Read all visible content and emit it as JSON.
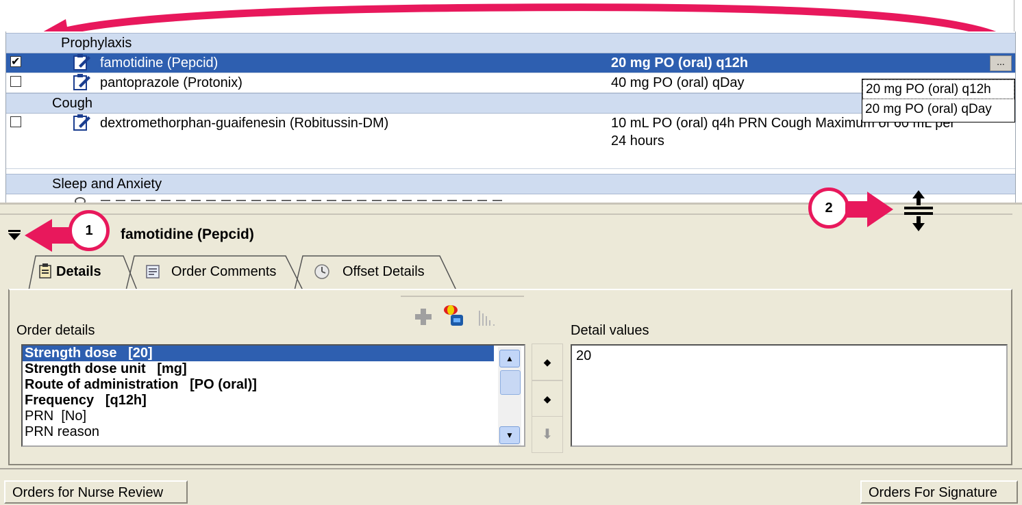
{
  "order_list": {
    "groups": [
      {
        "label": "Prophylaxis"
      },
      {
        "label": "Cough"
      },
      {
        "label": "Sleep and Anxiety"
      }
    ],
    "orders": [
      {
        "name": "famotidine (Pepcid)",
        "sig": "20 mg PO (oral) q12h",
        "checked": true,
        "selected": true
      },
      {
        "name": "pantoprazole (Protonix)",
        "sig": "40 mg PO (oral) qDay",
        "checked": false
      },
      {
        "name": "dextromethorphan-guaifenesin (Robitussin-DM)",
        "sig_line1": "10 mL PO (oral) q4h PRN Cough Maximum of 60 mL per",
        "sig_line2": "24 hours",
        "checked": false
      }
    ],
    "ellipsis_label": "...",
    "dose_options": [
      "20 mg PO (oral) q12h",
      "20 mg PO (oral) qDay"
    ]
  },
  "detail_panel": {
    "title": "famotidine (Pepcid)",
    "tabs": [
      {
        "label": "Details",
        "active": true
      },
      {
        "label": "Order Comments"
      },
      {
        "label": "Offset Details"
      }
    ],
    "order_details_label": "Order details",
    "detail_values_label": "Detail values",
    "details": [
      {
        "text": "Strength dose   [20]",
        "bold": true,
        "selected": true
      },
      {
        "text": "Strength dose unit   [mg]",
        "bold": true
      },
      {
        "text": "Route of administration   [PO (oral)]",
        "bold": true
      },
      {
        "text": "Frequency   [q12h]",
        "bold": true
      },
      {
        "text": "PRN  [No]",
        "bold": false
      },
      {
        "text": "PRN reason",
        "bold": false
      }
    ],
    "detail_value": "20"
  },
  "footer": {
    "nurse_review_label": "Orders for Nurse Review",
    "signature_label": "Orders For Signature"
  },
  "annotations": {
    "callout_1": "1",
    "callout_2": "2"
  },
  "colors": {
    "accent_selection": "#2e5fb0",
    "group_header": "#cfdcf0",
    "annotation": "#e8185c",
    "panel_bg": "#ece9d8"
  }
}
